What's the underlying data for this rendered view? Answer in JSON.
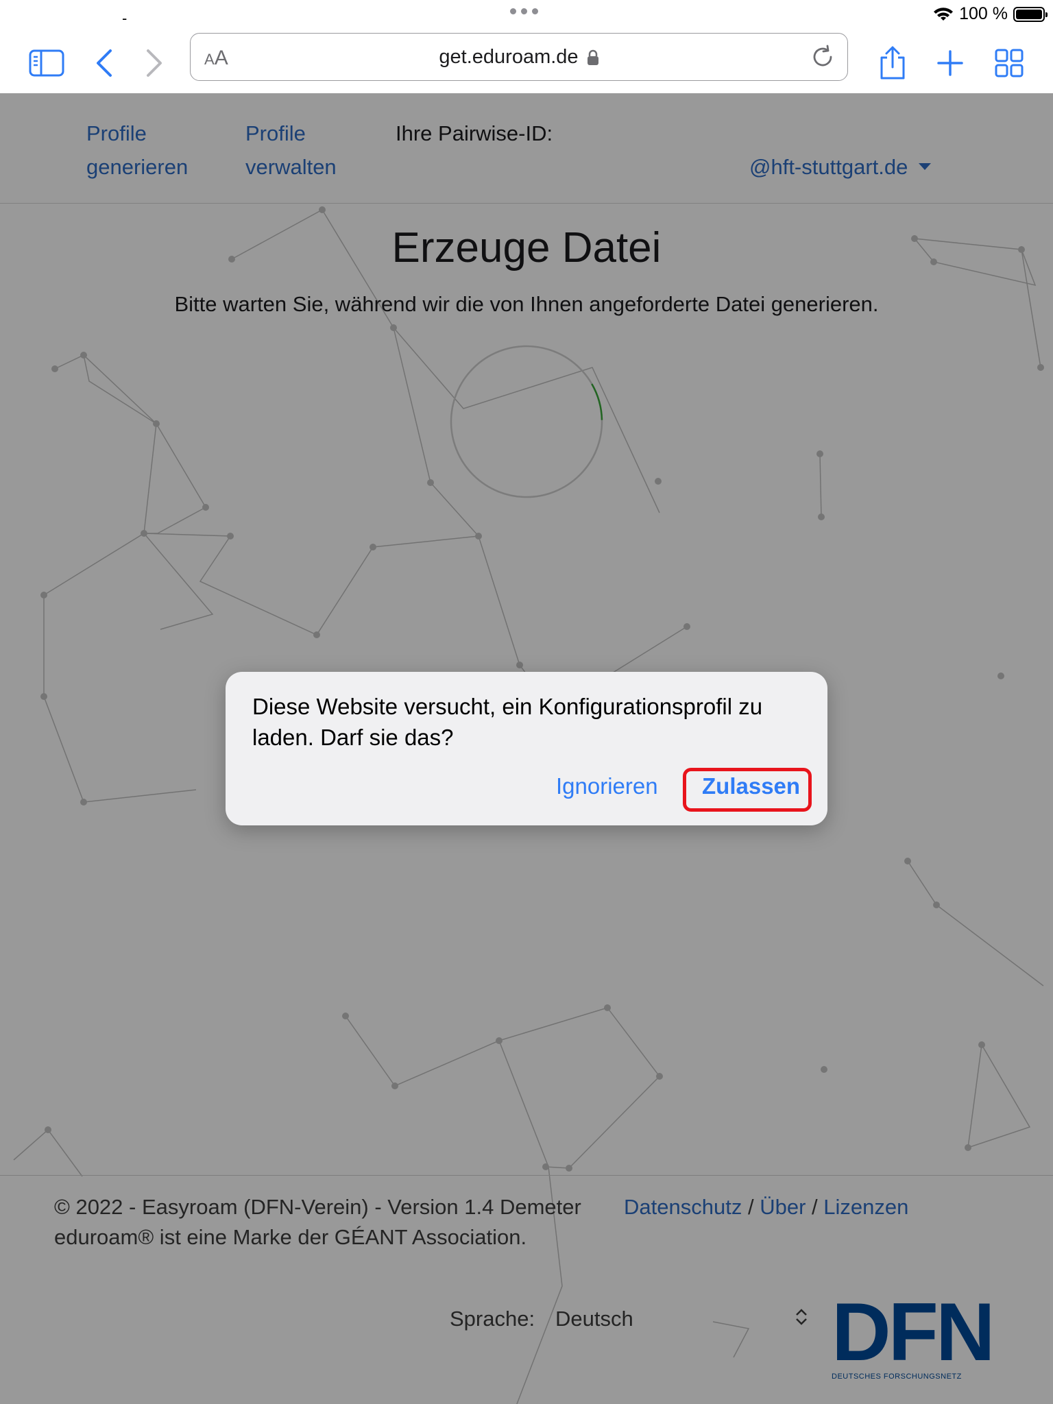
{
  "statusbar": {
    "dash": "-",
    "battery_text": "100 %"
  },
  "browser": {
    "text_size_label_small": "A",
    "text_size_label_large": "A",
    "url": "get.eduroam.de"
  },
  "nav": {
    "link1": [
      "Profile",
      "generieren"
    ],
    "link2": [
      "Profile",
      "verwalten"
    ],
    "pairwise_label": "Ihre Pairwise-ID:",
    "account_suffix": "@hft-stuttgart.de"
  },
  "main": {
    "title": "Erzeuge Datei",
    "subtitle": "Bitte warten Sie, während wir die von Ihnen angeforderte Datei generieren.",
    "progress": 0.08
  },
  "footer": {
    "copyright": "© 2022 - Easyroam (DFN-Verein) - Version 1.4 Demeter",
    "trademark": "eduroam® ist eine Marke der GÉANT Association.",
    "links": [
      "Datenschutz",
      "Über",
      "Lizenzen"
    ],
    "separator": "/",
    "language_label": "Sprache:",
    "language_value": "Deutsch",
    "logo_text": "DFN",
    "logo_subtitle": "DEUTSCHES FORSCHUNGSNETZ"
  },
  "alert": {
    "message": "Diese Website versucht, ein Konfigurationsprofil zu laden. Darf sie das?",
    "ignore_label": "Ignorieren",
    "allow_label": "Zulassen",
    "highlight_color": "#e8141c"
  },
  "colors": {
    "link": "#2d6bc4",
    "ios_blue": "#2f7cf6",
    "dim_overlay": "rgba(0,0,0,0.40)"
  }
}
